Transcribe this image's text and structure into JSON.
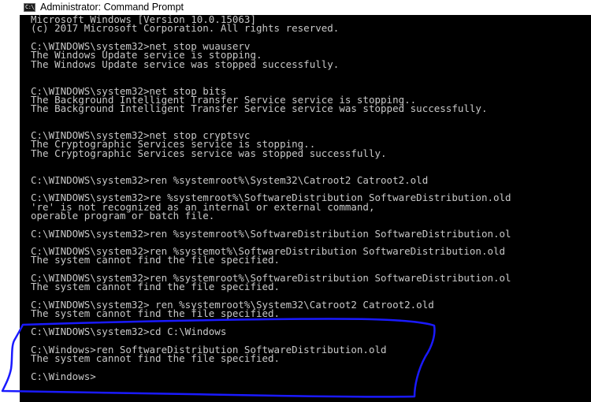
{
  "window": {
    "title": "Administrator: Command Prompt",
    "icon": "cmd-console-icon",
    "icon_glyph": "C:\\_"
  },
  "console": {
    "background_color": "#000000",
    "text_color": "#c8c8c8",
    "lines": [
      "Microsoft Windows [Version 10.0.15063]",
      "(c) 2017 Microsoft Corporation. All rights reserved.",
      "",
      "C:\\WINDOWS\\system32>net stop wuauserv",
      "The Windows Update service is stopping.",
      "The Windows Update service was stopped successfully.",
      "",
      "",
      "C:\\WINDOWS\\system32>net stop bits",
      "The Background Intelligent Transfer Service service is stopping..",
      "The Background Intelligent Transfer Service service was stopped successfully.",
      "",
      "",
      "C:\\WINDOWS\\system32>net stop cryptsvc",
      "The Cryptographic Services service is stopping..",
      "The Cryptographic Services service was stopped successfully.",
      "",
      "",
      "C:\\WINDOWS\\system32>ren %systemroot%\\System32\\Catroot2 Catroot2.old",
      "",
      "C:\\WINDOWS\\system32>re %systemroot%\\SoftwareDistribution SoftwareDistribution.old",
      "'re' is not recognized as an internal or external command,",
      "operable program or batch file.",
      "",
      "C:\\WINDOWS\\system32>ren %systemroot%\\SoftwareDistribution SoftwareDistribution.ol",
      "",
      "C:\\WINDOWS\\system32>ren %systemot%\\SoftwareDistribution SoftwareDistribution.old",
      "The system cannot find the file specified.",
      "",
      "C:\\WINDOWS\\system32>ren %systemroot%\\SoftwareDistribution SoftwareDistribution.ol",
      "The system cannot find the file specified.",
      "",
      "C:\\WINDOWS\\system32> ren %systemroot%\\System32\\Catroot2 Catroot2.old",
      "The system cannot find the file specified.",
      "",
      "C:\\WINDOWS\\system32>cd C:\\Windows",
      "",
      "C:\\Windows>ren SoftwareDistribution SoftwareDistribution.old",
      "The system cannot find the file specified.",
      "",
      "C:\\Windows>"
    ]
  },
  "annotation": {
    "type": "hand-drawn-highlight",
    "color": "#1a1aff",
    "highlights": "last commands from 'cd C:\\Windows' to the 'C:\\Windows>' prompt"
  }
}
